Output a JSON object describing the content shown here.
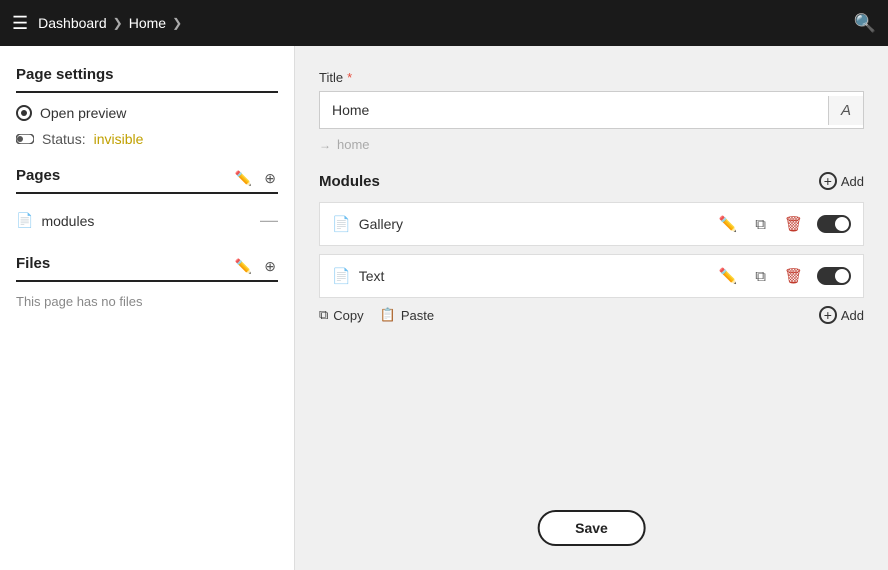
{
  "nav": {
    "hamburger_label": "☰",
    "breadcrumb": [
      {
        "label": "Dashboard"
      },
      {
        "label": "Home"
      }
    ],
    "search_label": "🔍"
  },
  "sidebar": {
    "page_settings_title": "Page settings",
    "open_preview_label": "Open preview",
    "status_label": "Status:",
    "status_value": "invisible",
    "pages_title": "Pages",
    "pages_items": [
      {
        "label": "modules"
      }
    ],
    "files_title": "Files",
    "no_files_text": "This page has no files"
  },
  "main": {
    "title_label": "Title",
    "required_marker": "*",
    "title_value": "Home",
    "font_btn_label": "A",
    "slug_arrow": "→",
    "slug_value": "home",
    "modules_title": "Modules",
    "add_label": "Add",
    "modules": [
      {
        "name": "Gallery"
      },
      {
        "name": "Text"
      }
    ],
    "copy_label": "Copy",
    "paste_label": "Paste",
    "add_bottom_label": "Add",
    "save_label": "Save"
  }
}
